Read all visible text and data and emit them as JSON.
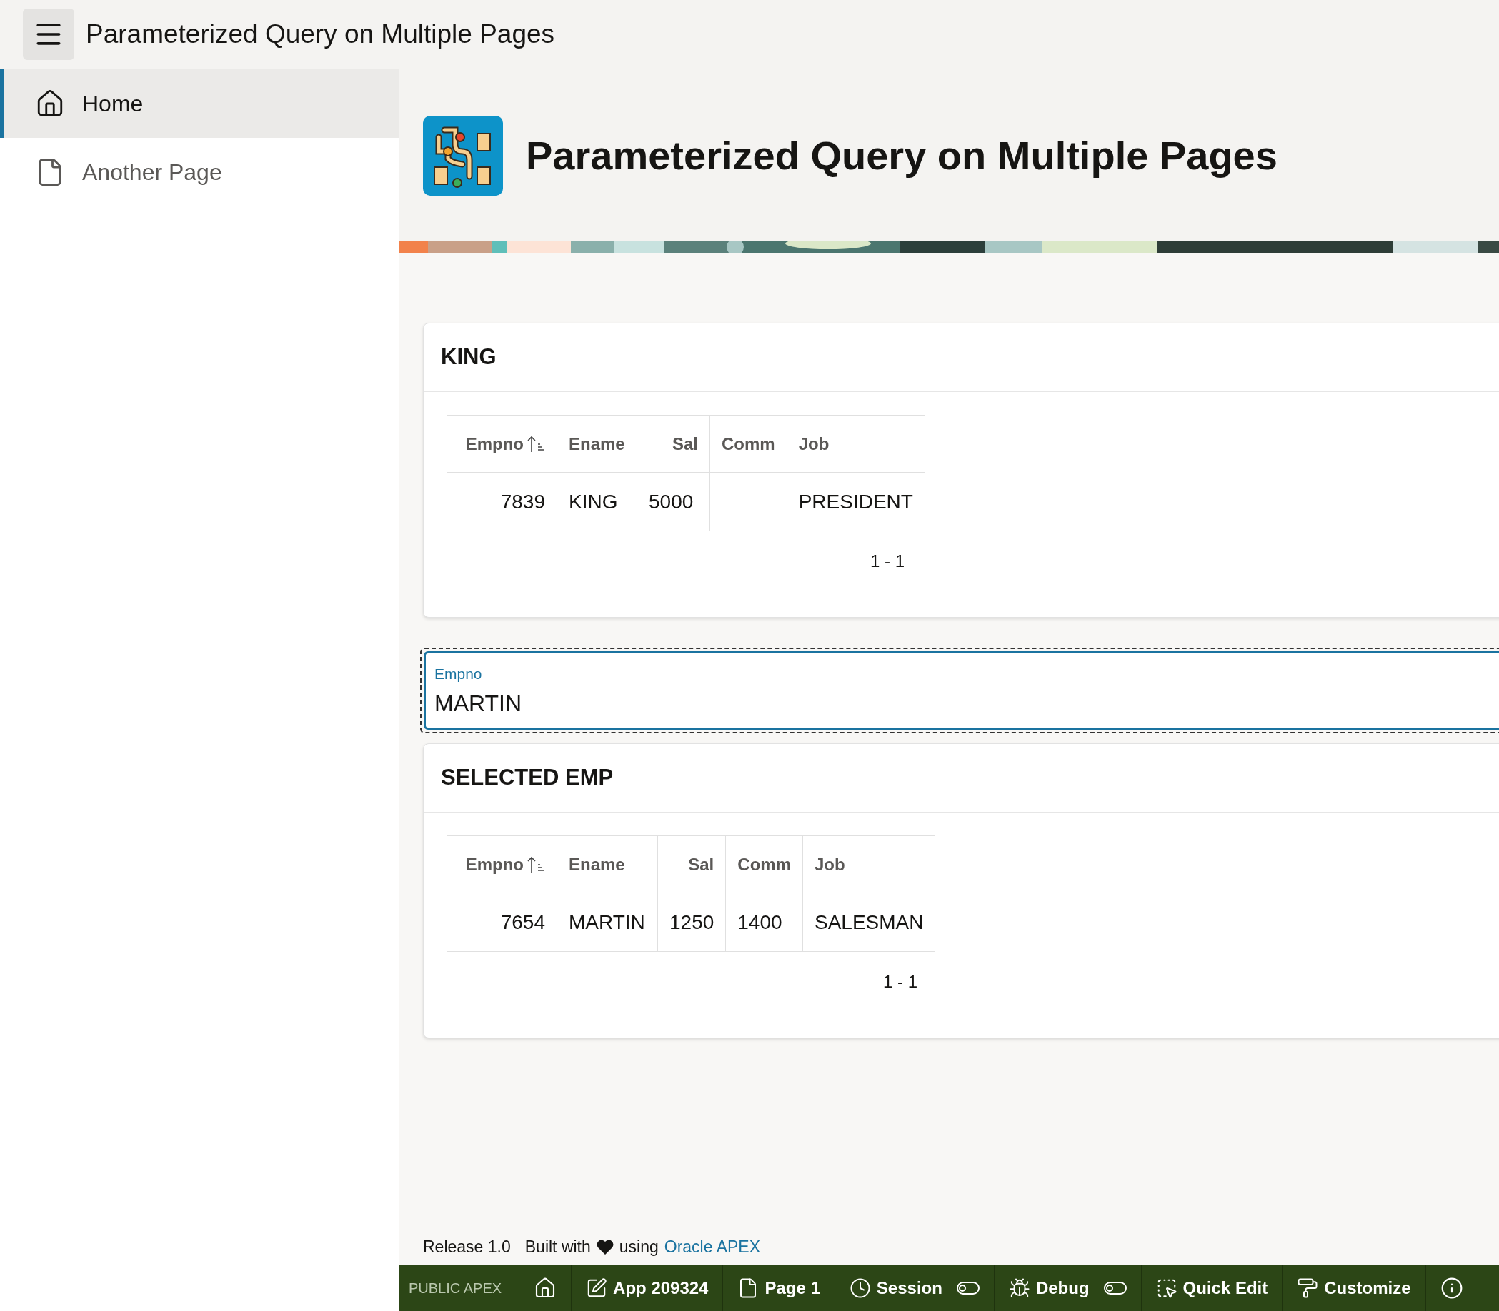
{
  "header": {
    "title": "Parameterized Query on Multiple Pages"
  },
  "sidebar": {
    "items": [
      {
        "label": "Home",
        "selected": true
      },
      {
        "label": "Another Page",
        "selected": false
      }
    ]
  },
  "page": {
    "title": "Parameterized Query on Multiple Pages"
  },
  "regions": [
    {
      "kind": "report",
      "title": "KING",
      "columns": [
        {
          "label": "Empno",
          "sorted": true
        },
        {
          "label": "Ename",
          "sorted": false
        },
        {
          "label": "Sal",
          "sorted": false
        },
        {
          "label": "Comm",
          "sorted": false
        },
        {
          "label": "Job",
          "sorted": false
        }
      ],
      "rows": [
        [
          "7839",
          "KING",
          "5000",
          "",
          "PRESIDENT"
        ]
      ],
      "pagination": "1 - 1"
    },
    {
      "kind": "field",
      "label": "Empno",
      "value": "MARTIN"
    },
    {
      "kind": "report",
      "title": "SELECTED EMP",
      "columns": [
        {
          "label": "Empno",
          "sorted": true
        },
        {
          "label": "Ename",
          "sorted": false
        },
        {
          "label": "Sal",
          "sorted": false
        },
        {
          "label": "Comm",
          "sorted": false
        },
        {
          "label": "Job",
          "sorted": false
        }
      ],
      "rows": [
        [
          "7654",
          "MARTIN",
          "1250",
          "1400",
          "SALESMAN"
        ]
      ],
      "pagination": "1 - 1"
    }
  ],
  "footer": {
    "release": "Release 1.0",
    "built_with": "Built with",
    "using": "using",
    "link": "Oracle APEX"
  },
  "dev_toolbar": {
    "label": "PUBLIC APEX",
    "items": [
      {
        "kind": "icon"
      },
      {
        "kind": "button",
        "label": "App 209324"
      },
      {
        "kind": "button",
        "label": "Page 1"
      },
      {
        "kind": "toggle",
        "label": "Session",
        "on": false
      },
      {
        "kind": "toggle",
        "label": "Debug",
        "on": false
      },
      {
        "kind": "button",
        "label": "Quick Edit"
      },
      {
        "kind": "button",
        "label": "Customize"
      },
      {
        "kind": "icon"
      }
    ]
  }
}
